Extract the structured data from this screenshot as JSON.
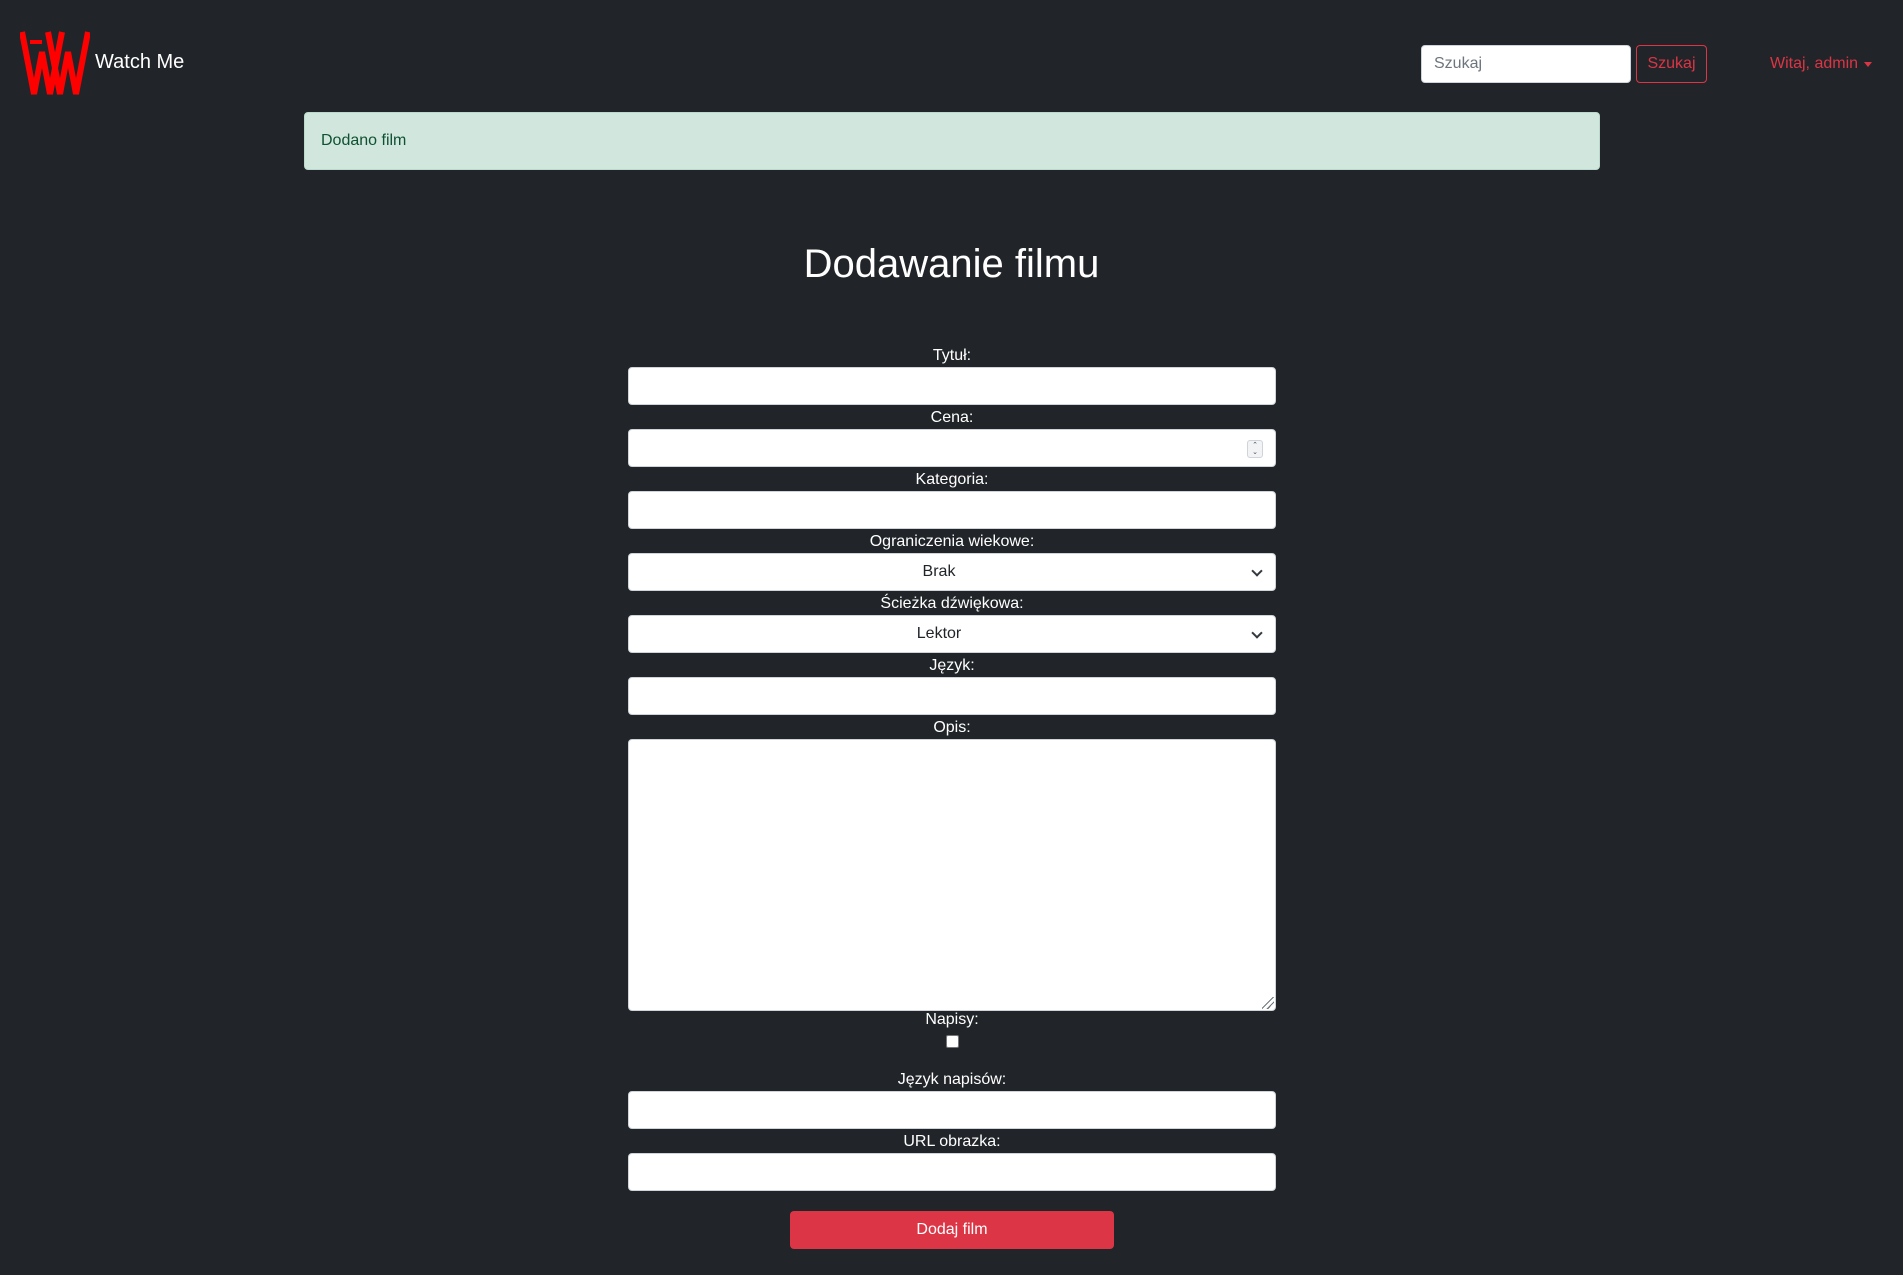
{
  "navbar": {
    "brand_name": "Watch Me",
    "search_placeholder": "Szukaj",
    "search_button": "Szukaj",
    "user_menu": "Witaj, admin"
  },
  "alert": {
    "message": "Dodano film"
  },
  "page": {
    "title": "Dodawanie filmu"
  },
  "form": {
    "title_label": "Tytuł:",
    "title_value": "",
    "price_label": "Cena:",
    "price_value": "",
    "category_label": "Kategoria:",
    "category_value": "",
    "age_label": "Ograniczenia wiekowe:",
    "age_selected": "Brak",
    "audio_label": "Ścieżka dźwiękowa:",
    "audio_selected": "Lektor",
    "language_label": "Język:",
    "language_value": "",
    "description_label": "Opis:",
    "description_value": "",
    "subtitles_label": "Napisy:",
    "subtitles_checked": false,
    "subtitles_language_label": "Język napisów:",
    "subtitles_language_value": "",
    "image_url_label": "URL obrazka:",
    "image_url_value": "",
    "submit_label": "Dodaj film"
  },
  "colors": {
    "background": "#212529",
    "accent": "#dc3545",
    "alert_bg": "#d1e7dd",
    "alert_text": "#0f5132"
  }
}
